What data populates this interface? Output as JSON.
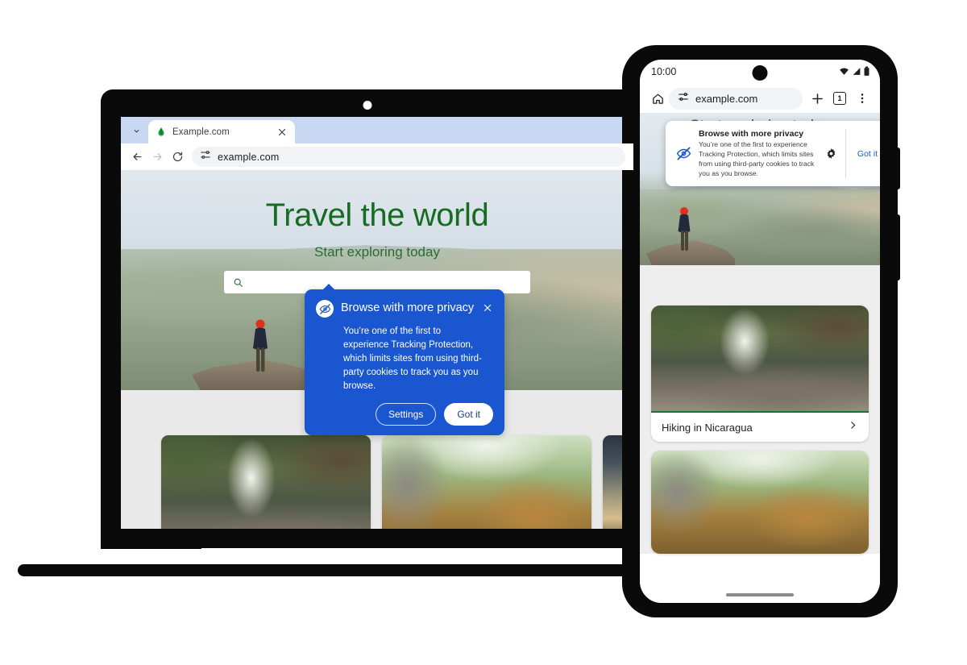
{
  "meta": {
    "scene": "chrome-tracking-protection-promo-on-laptop-and-phone",
    "accent_blue": "#1a56cf",
    "brand_green": "#1e7031",
    "headline_green": "#176b22"
  },
  "laptop": {
    "browser": {
      "tab": {
        "title": "Example.com",
        "favicon_name": "example-site-favicon",
        "close_label": "✕",
        "chevron_name": "tab-search-chevron-icon"
      },
      "toolbar": {
        "back_name": "back-icon",
        "forward_name": "forward-icon",
        "reload_name": "reload-icon",
        "site_settings_name": "tune-site-settings-icon",
        "url": "example.com"
      }
    },
    "page": {
      "headline": "Travel the world",
      "subheadline": "Start exploring today",
      "search_placeholder": "",
      "search_icon_name": "search-icon",
      "carousel": {
        "prev_label": "‹",
        "next_label": "›",
        "prev_enabled": "false",
        "next_enabled": "true"
      },
      "cards": [
        {
          "alt": "Waterfall hiker",
          "art": "art-waterfall"
        },
        {
          "alt": "Log cabin in forest",
          "art": "art-cabin"
        },
        {
          "alt": "Road at sunset",
          "art": "art-sunset"
        }
      ]
    },
    "dialog": {
      "icon_name": "eye-off-privacy-icon",
      "title": "Browse with more privacy",
      "body": "You’re one of the first to experience Tracking Protection, which limits sites from using third-party cookies to track you as you browse.",
      "close_label": "✕",
      "secondary_button": "Settings",
      "primary_button": "Got it"
    }
  },
  "phone": {
    "status_bar": {
      "time": "10:00",
      "icons": [
        "wifi-icon",
        "cellular-signal-icon",
        "battery-icon"
      ]
    },
    "toolbar": {
      "home_name": "home-icon",
      "site_settings_name": "tune-site-settings-icon",
      "url": "example.com",
      "new_tab_label": "+",
      "tab_count": "1",
      "menu_name": "more-vertical-icon"
    },
    "page": {
      "headline": "Start exploring today",
      "search_placeholder": "",
      "search_icon_name": "search-icon",
      "cards": [
        {
          "title": "Hiking in Nicaragua",
          "chevron": "›",
          "art": "art-waterfall"
        },
        {
          "title": "",
          "chevron": "",
          "art": "art-cabin"
        }
      ]
    },
    "dialog": {
      "icon_name": "eye-off-privacy-icon",
      "title": "Browse with more privacy",
      "body": "You’re one of the first to experience Tracking Protection, which limits sites from using third-party cookies to track you as you browse.",
      "gear_name": "gear-icon",
      "primary_button": "Got it"
    }
  }
}
